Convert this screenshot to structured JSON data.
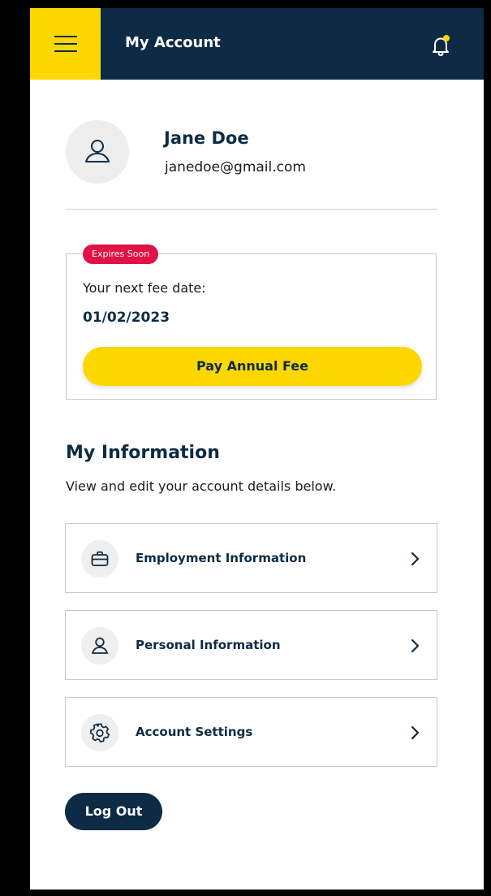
{
  "header": {
    "title": "My Account",
    "menu_icon": "hamburger-icon",
    "notification_icon": "bell-icon"
  },
  "profile": {
    "name": "Jane Doe",
    "email": "janedoe@gmail.com",
    "avatar_icon": "user-icon"
  },
  "fee_card": {
    "badge": "Expires Soon",
    "label": "Your next fee date:",
    "date": "01/02/2023",
    "button_label": "Pay Annual Fee"
  },
  "info_section": {
    "title": "My Information",
    "subtitle": "View and edit your account details below.",
    "items": [
      {
        "label": "Employment Information",
        "icon": "briefcase-icon"
      },
      {
        "label": "Personal Information",
        "icon": "user-icon"
      },
      {
        "label": "Account Settings",
        "icon": "gear-icon"
      }
    ]
  },
  "logout_label": "Log Out",
  "colors": {
    "navy": "#0d2b45",
    "yellow": "#ffd700",
    "badge_red": "#e11245",
    "notification_dot": "#ffd700",
    "border": "#c9c9c9"
  }
}
